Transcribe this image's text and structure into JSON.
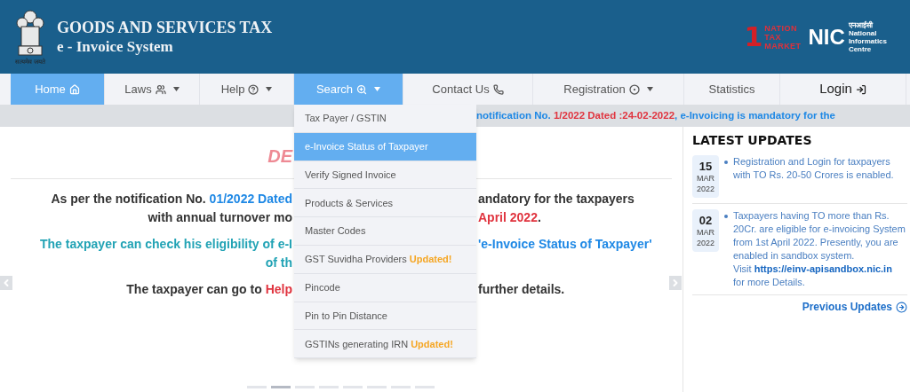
{
  "header": {
    "motto": "सत्यमेव जयते",
    "title": "GOODS AND SERVICES TAX",
    "subtitle": "e - Invoice System",
    "partner_logo": {
      "numeral": "1",
      "lines": [
        "NATION",
        "TAX",
        "MARKET"
      ]
    },
    "nic_logo": {
      "mark": "NIC",
      "hindi": "एनआईसी",
      "lines": [
        "National",
        "Informatics",
        "Centre"
      ]
    }
  },
  "nav": [
    {
      "label": "Home",
      "highlighted": true,
      "dropdown": false
    },
    {
      "label": "Laws",
      "highlighted": false,
      "dropdown": true
    },
    {
      "label": "Help",
      "highlighted": false,
      "dropdown": true
    },
    {
      "label": "Search",
      "highlighted": true,
      "dropdown": true
    },
    {
      "label": "Contact Us",
      "highlighted": false,
      "dropdown": false
    },
    {
      "label": "Registration",
      "highlighted": false,
      "dropdown": true
    },
    {
      "label": "Statistics",
      "highlighted": false,
      "dropdown": false
    },
    {
      "label": "Login",
      "highlighted": false,
      "dropdown": false
    }
  ],
  "search_menu": [
    {
      "label": "Tax Payer / GSTIN",
      "selected": false
    },
    {
      "label": "e-Invoice Status of Taxpayer",
      "selected": true
    },
    {
      "label": "Verify Signed Invoice",
      "selected": false
    },
    {
      "label": "Products & Services",
      "selected": false
    },
    {
      "label": "Master Codes",
      "selected": false
    },
    {
      "label": "GST Suvidha Providers",
      "badge": "Updated!",
      "selected": false
    },
    {
      "label": "Pincode",
      "selected": false
    },
    {
      "label": "Pin to Pin Distance",
      "selected": false
    },
    {
      "label": "GSTINs generating IRN",
      "badge": "Updated!",
      "selected": false
    }
  ],
  "ticker": [
    {
      "text": "notification No. ",
      "color": "#1e88e5"
    },
    {
      "text": "1/2022 Dated :24-02-2022",
      "color": "#e0343f"
    },
    {
      "text": ", e-Invoicing is mandatory for the",
      "color": "#1e88e5"
    }
  ],
  "banner": {
    "heading_fragment": "DE",
    "lines": [
      {
        "left": [
          {
            "text": "As per the notification No. ",
            "color": "#333333"
          },
          {
            "text": "01/2022 Dated",
            "color": "#1e88e5"
          }
        ],
        "right": [
          {
            "text": "andatory for the taxpayers",
            "color": "#333333"
          }
        ]
      },
      {
        "left": [
          {
            "text": "with annual turnover mo",
            "color": "#333333"
          }
        ],
        "right": [
          {
            "text": "April 2022",
            "color": "#e0343f"
          },
          {
            "text": "."
          }
        ]
      },
      {
        "left": [
          {
            "text": "The taxpayer can check his eligibility of e-I",
            "color": "#22a3b5"
          }
        ],
        "right": [
          {
            "text": "'e-Invoice Status of Taxpayer'",
            "color": "#1e88e5"
          }
        ]
      },
      {
        "left": [
          {
            "text": "of th",
            "color": "#22a3b5"
          }
        ]
      },
      {
        "left": [
          {
            "text": "The taxpayer can go to ",
            "color": "#333333"
          },
          {
            "text": "Help",
            "color": "#e0343f"
          }
        ],
        "right": [
          {
            "text": "further details.",
            "color": "#333333"
          }
        ]
      }
    ],
    "slides": [
      {
        "selected": false
      },
      {
        "selected": true
      },
      {
        "selected": false
      },
      {
        "selected": false
      },
      {
        "selected": false
      },
      {
        "selected": false
      },
      {
        "selected": false
      },
      {
        "selected": false
      }
    ]
  },
  "latest_updates": {
    "title": "LATEST UPDATES",
    "items": [
      {
        "day": "15",
        "month": "MAR",
        "year": "2022",
        "text": "Registration and Login for taxpayers with TO Rs. 20-50 Crores is enabled."
      },
      {
        "day": "02",
        "month": "MAR",
        "year": "2022",
        "text": "Taxpayers having TO more than Rs. 20Cr. are eligible for e-invoicing System from 1st April 2022. Presently, you are enabled in sandbox system.",
        "visit": "Visit",
        "link": "https://einv-apisandbox.nic.in",
        "after": "for more Details."
      }
    ],
    "more": "Previous Updates"
  }
}
